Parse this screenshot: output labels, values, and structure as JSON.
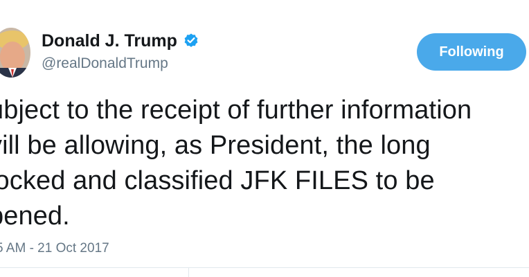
{
  "author": {
    "display_name": "Donald J. Trump",
    "handle": "@realDonaldTrump",
    "verified_icon": "verified-badge-icon",
    "avatar": "user-avatar"
  },
  "follow_button": {
    "label": "Following"
  },
  "tweet": {
    "lines": [
      "ubject to the receipt of further information",
      "vill be allowing, as President, the long",
      "locked and classified JFK FILES to be",
      "pened."
    ],
    "timestamp": "5 AM - 21 Oct 2017"
  },
  "colors": {
    "accent": "#4aa9ea",
    "text": "#14171a",
    "muted": "#657786",
    "verified": "#1da1f2"
  }
}
